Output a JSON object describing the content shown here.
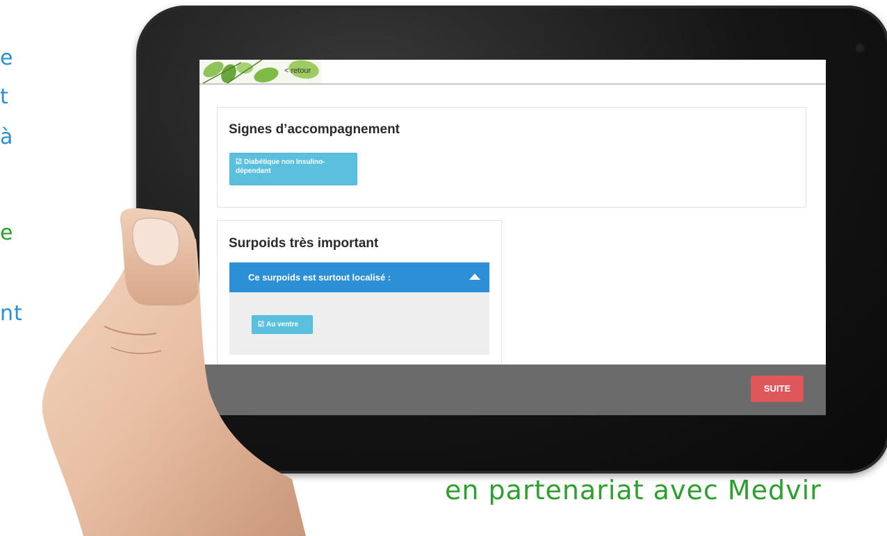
{
  "promo": {
    "left_lines": [
      {
        "text": "e",
        "color": "blue"
      },
      {
        "text": "t",
        "color": "blue"
      },
      {
        "text": "à",
        "color": "blue"
      },
      {
        "text": "e",
        "color": "green"
      },
      {
        "text": "nt",
        "color": "blue"
      }
    ],
    "partner_text": "en partenariat avec Medvir"
  },
  "header": {
    "back_label": "< retour"
  },
  "sections": [
    {
      "title": "Signes d’accompagnement",
      "chips": [
        "Diabétique non Insulino-",
        "dépendant"
      ]
    },
    {
      "title": "Surpoids très important",
      "accordion": {
        "label": "Ce surpoids est surtout localisé :",
        "expanded": true,
        "chips": [
          "Au ventre"
        ]
      }
    }
  ],
  "footer": {
    "next_label": "SUITE"
  },
  "icons": {
    "check": "checkbox-checked-icon",
    "caret": "caret-up-icon",
    "camera": "camera-icon"
  },
  "colors": {
    "primary": "#2d8fd5",
    "chip": "#5bc0de",
    "next": "#e0575b",
    "footer": "#6b6b6b",
    "green_text": "#2e9e2e",
    "blue_text": "#2a8fd4"
  }
}
